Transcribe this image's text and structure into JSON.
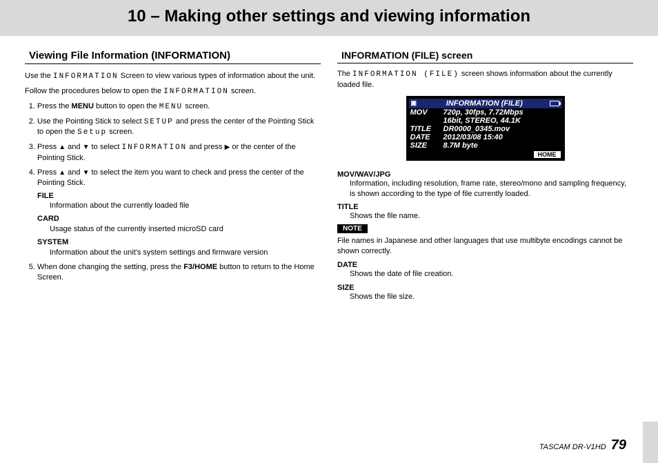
{
  "chapter": {
    "title": "10 – Making other settings and viewing information"
  },
  "left": {
    "section_title": "Viewing File Information (INFORMATION)",
    "intro1a": "Use the ",
    "intro1_lcd": "INFORMATION",
    "intro1b": " Screen to view various types of information about the unit.",
    "intro2a": "Follow the procedures below to open the ",
    "intro2_lcd": "INFORMATION",
    "intro2b": " screen.",
    "steps": [
      {
        "pre": "Press the ",
        "bold1": "MENU",
        "mid": " button to open the ",
        "lcd": "MENU",
        "post": " screen."
      },
      {
        "pre": "Use the Pointing Stick to select ",
        "lcd": "SETUP",
        "mid": " and press the center of the Pointing Stick to open the ",
        "lcd2": "Setup",
        "post": " screen."
      },
      {
        "pre": "Press ",
        "a1": "▲",
        "mid1": " and ",
        "a2": "▼",
        "mid2": " to select ",
        "lcd": "INFORMATION",
        "mid3": " and press ",
        "a3": "▶",
        "post": " or the center of the Pointing Stick."
      },
      {
        "pre": "Press ",
        "a1": "▲",
        "mid1": " and ",
        "a2": "▼",
        "post": " to select the item you want to check and press the center of the Pointing Stick."
      },
      {
        "pre": "When done changing the setting, press the ",
        "bold1": "F3/HOME",
        "post": " button to return to the Home Screen."
      }
    ],
    "defs": [
      {
        "term": "FILE",
        "body": "Information about the currently loaded file"
      },
      {
        "term": "CARD",
        "body": "Usage status of the currently inserted microSD card"
      },
      {
        "term": "SYSTEM",
        "body": "Information about the unit's system settings and firmware version"
      }
    ]
  },
  "right": {
    "section_title": "INFORMATION (FILE) screen",
    "intro_a": "The ",
    "intro_lcd": "INFORMATION (FILE)",
    "intro_b": " screen shows information about the currently loaded file.",
    "lcd": {
      "title": "INFORMATION (FILE)",
      "rows": [
        {
          "label": "MOV",
          "val": "720p, 30fps, 7.72Mbps"
        },
        {
          "label": "",
          "val": "16bit, STEREO, 44.1K"
        },
        {
          "label": "TITLE",
          "val": "DR0000_0345.mov"
        },
        {
          "label": "DATE",
          "val": "2012/03/08 15:40"
        },
        {
          "label": "SIZE",
          "val": "8.7M byte"
        }
      ],
      "home": "HOME"
    },
    "fields": [
      {
        "name": "MOV/WAV/JPG",
        "body": "Information, including resolution, frame rate, stereo/mono and sampling frequency, is shown according to the type of file currently loaded."
      },
      {
        "name": "TITLE",
        "body": "Shows the file name."
      }
    ],
    "note_label": "NOTE",
    "note_body": "File names in Japanese and other languages that use multibyte encodings cannot be shown correctly.",
    "fields2": [
      {
        "name": "DATE",
        "body": "Shows the date of file creation."
      },
      {
        "name": "SIZE",
        "body": "Shows the file size."
      }
    ]
  },
  "footer": {
    "product": "TASCAM  DR-V1HD",
    "page": "79"
  }
}
